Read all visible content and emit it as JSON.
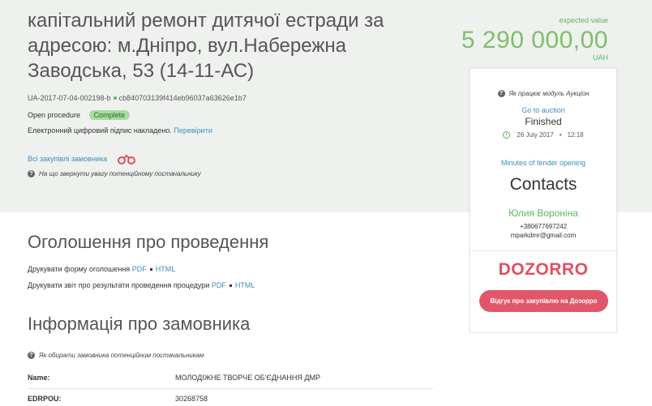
{
  "tender": {
    "title": "капітальний ремонт дитячої естради за адресою: м.Дніпро, вул.Набережна Заводська, 53 (14-11-АС)",
    "id": "UA-2017-07-04-002198-b",
    "hash": "cb840703139f414eb96037a63626e1b7",
    "procedure": "Open procedure",
    "status": "Complete",
    "signature_text": "Електронний цифровий підпис накладено.",
    "signature_link": "Перевірити",
    "all_purchases_link": "Всі закупівлі замовника",
    "notice": "На що звернути увагу потенційному постачальнику"
  },
  "value": {
    "label": "expected value",
    "amount": "5 290 000,00",
    "currency": "UAH"
  },
  "auction": {
    "how_it_works": "Як працює модуль Аукціон",
    "goto_link": "Go to auction",
    "status": "Finished",
    "date": "26 July 2017",
    "time": "12:18",
    "minutes_link": "Minutes of tender opening"
  },
  "contacts": {
    "heading": "Contacts",
    "name": "Юлия Вороніна",
    "phone": "+380677697242",
    "email": "mparkdmr@gmail.com"
  },
  "dozorro": {
    "logo": "DOZORRO",
    "button": "Відгук про закупівлю на Дозорро"
  },
  "announcement": {
    "heading": "Оголошення про проведення",
    "print_form_label": "Друкувати форму оголошення",
    "print_report_label": "Друкувати звіт про результати проведення процедури",
    "pdf": "PDF",
    "html": "HTML"
  },
  "customer": {
    "heading": "Інформація про замовника",
    "note": "Як обирати замовника потенційним постачальникам",
    "rows": [
      {
        "label": "Name:",
        "value": "МОЛОДІЖНЕ ТВОРЧЕ ОБ'ЄДНАННЯ ДМР"
      },
      {
        "label": "EDRPOU:",
        "value": "30268758"
      }
    ]
  },
  "colors": {
    "accent_green": "#5cb85c",
    "link_blue": "#3c8dbc",
    "dozorro_red": "#e2566a"
  }
}
